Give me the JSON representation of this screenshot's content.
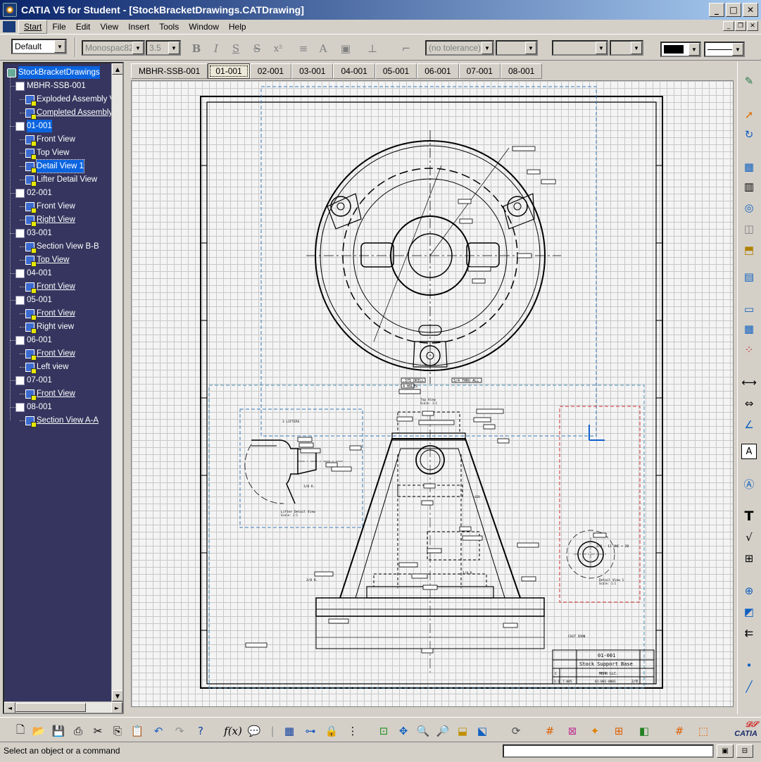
{
  "window": {
    "title": "CATIA V5 for Student - [StockBracketDrawings.CATDrawing]",
    "minimize": "_",
    "maximize": "□",
    "close": "✕"
  },
  "menu": {
    "items": [
      "Start",
      "File",
      "Edit",
      "View",
      "Insert",
      "Tools",
      "Window",
      "Help"
    ],
    "active": "Start"
  },
  "format_toolbar": {
    "style": "Default",
    "font": "Monospac821",
    "font_size": "3.5",
    "bold": "B",
    "italic": "I",
    "underline": "S",
    "strike": "S",
    "superscript": "x²",
    "tolerance": "(no tolerance)"
  },
  "tree": {
    "root": "StockBracketDrawings",
    "nodes": [
      {
        "label": "MBHR-SSB-001",
        "level": 1,
        "icon": "sheet"
      },
      {
        "label": "Exploded Assembly Vie",
        "level": 2,
        "icon": "view"
      },
      {
        "label": "Completed Assembly V",
        "level": 2,
        "icon": "view",
        "underline": true
      },
      {
        "label": "01-001",
        "level": 1,
        "icon": "sheet",
        "selected": true
      },
      {
        "label": "Front View",
        "level": 2,
        "icon": "view"
      },
      {
        "label": "Top View",
        "level": 2,
        "icon": "view"
      },
      {
        "label": "Detail View 1",
        "level": 2,
        "icon": "view",
        "selected": true
      },
      {
        "label": "Lifter Detail View",
        "level": 2,
        "icon": "view"
      },
      {
        "label": "02-001",
        "level": 1,
        "icon": "sheet"
      },
      {
        "label": "Front View",
        "level": 2,
        "icon": "view"
      },
      {
        "label": "Right View",
        "level": 2,
        "icon": "view",
        "underline": true
      },
      {
        "label": "03-001",
        "level": 1,
        "icon": "sheet"
      },
      {
        "label": "Section View B-B",
        "level": 2,
        "icon": "view"
      },
      {
        "label": "Top View",
        "level": 2,
        "icon": "view",
        "underline": true
      },
      {
        "label": "04-001",
        "level": 1,
        "icon": "sheet"
      },
      {
        "label": "Front View",
        "level": 2,
        "icon": "view",
        "underline": true
      },
      {
        "label": "05-001",
        "level": 1,
        "icon": "sheet"
      },
      {
        "label": "Front View",
        "level": 2,
        "icon": "view",
        "underline": true
      },
      {
        "label": "Right view",
        "level": 2,
        "icon": "view"
      },
      {
        "label": "06-001",
        "level": 1,
        "icon": "sheet"
      },
      {
        "label": "Front View",
        "level": 2,
        "icon": "view",
        "underline": true
      },
      {
        "label": "Left view",
        "level": 2,
        "icon": "view"
      },
      {
        "label": "07-001",
        "level": 1,
        "icon": "sheet"
      },
      {
        "label": "Front View",
        "level": 2,
        "icon": "view",
        "underline": true
      },
      {
        "label": "08-001",
        "level": 1,
        "icon": "sheet"
      },
      {
        "label": "Section View A-A",
        "level": 2,
        "icon": "view",
        "underline": true
      }
    ]
  },
  "sheet_tabs": {
    "tabs": [
      "MBHR-SSB-001",
      "01-001",
      "02-001",
      "03-001",
      "04-001",
      "05-001",
      "06-001",
      "07-001",
      "08-001"
    ],
    "active": "01-001"
  },
  "drawing": {
    "title_block": {
      "sheet_number": "01-001",
      "part_name": "Stock Support Base",
      "company": "MBHR LLC.",
      "drawing_number": "01-001-0001",
      "sheet_count": "2/8",
      "size": "C",
      "scale": "1:1",
      "weight": "7.085"
    },
    "labels": {
      "lifter_detail": "Lifter Detail View",
      "lifter_detail_scale": "Scale: 1:1",
      "detail_view": "Detail View 1",
      "detail_view_scale": "Scale: 1:1",
      "top_view": "Top View",
      "top_view_scale": "Scale: 1:1",
      "material": "CAST IRON",
      "lifters": "3 LIFTERS",
      "drill": ".375 DRILL",
      "holes": "4 HOLES",
      "thru": "3/4 THRU ALL",
      "radius_lifter": "3/8 R.",
      "radius_base": "3/8 R.",
      "radius_body": "1/8 R.",
      "radius_fillet": ".020",
      "detail_dim": "3/8 - 11 UNC • 2B"
    }
  },
  "status": {
    "message": "Select an object or a command"
  },
  "brand": "CATIA"
}
